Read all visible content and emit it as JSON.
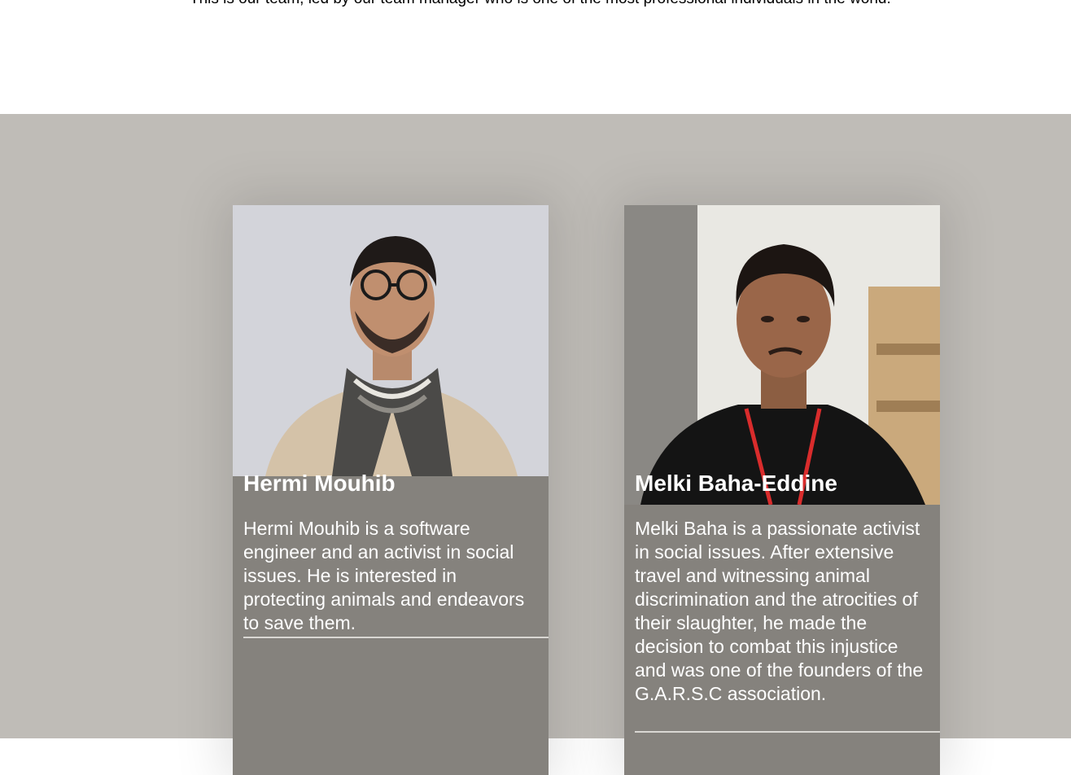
{
  "intro": {
    "text": "This is our team, led by our team manager who is one of the most professional individuals in the world."
  },
  "team": [
    {
      "name": "Hermi Mouhib",
      "bio": "Hermi Mouhib is a software engineer and an activist in social issues. He is interested in protecting animals and endeavors to save them.",
      "photo_desc": "portrait-photo"
    },
    {
      "name": "Melki Baha-Eddine",
      "bio": "Melki Baha is a passionate activist in social issues. After extensive travel and witnessing animal discrimination and the atrocities of their slaughter, he made the decision to combat this injustice and was one of the founders of the G.A.R.S.C association.",
      "photo_desc": "portrait-photo"
    }
  ],
  "colors": {
    "section_bg": "#bfbcb7",
    "card_bg": "#85827d",
    "text_light": "#ffffff"
  }
}
